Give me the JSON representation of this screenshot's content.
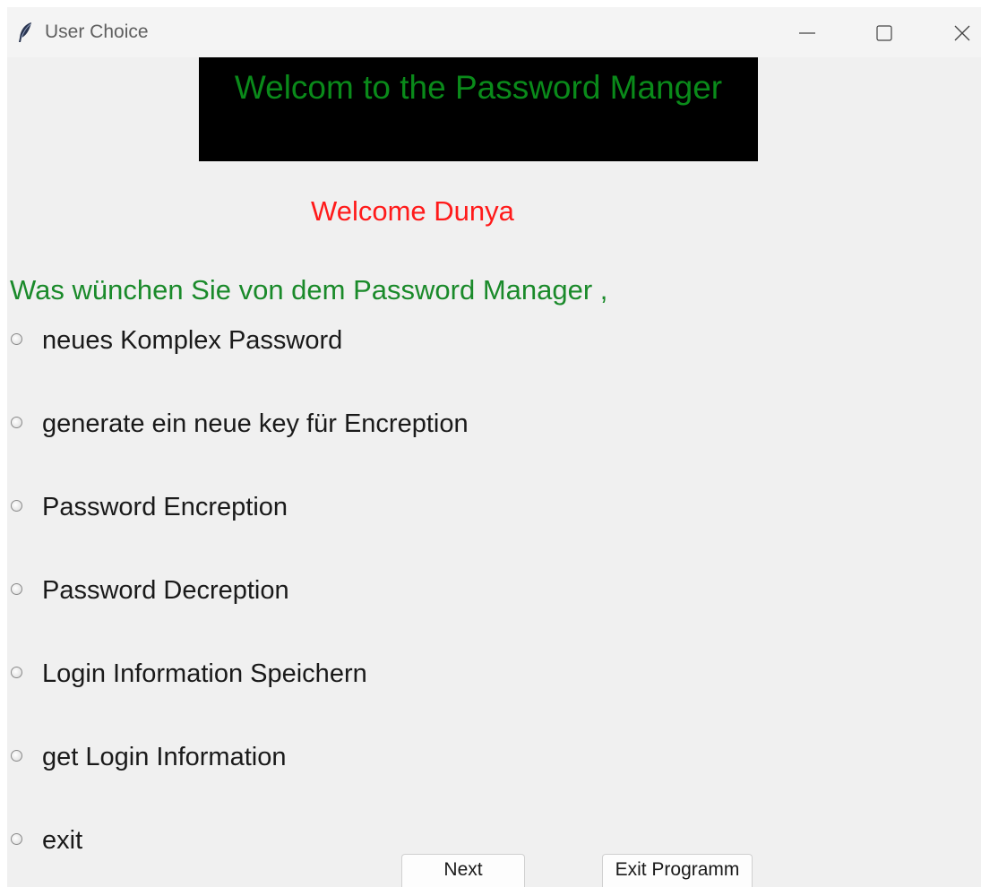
{
  "window": {
    "title": "User Choice",
    "icon": "feather-icon",
    "controls": [
      "minimize-icon",
      "maximize-icon",
      "close-icon"
    ]
  },
  "header": {
    "title": "Welcom to the Password Manger",
    "background": "#000000",
    "color": "#0a8a1a"
  },
  "welcome": {
    "text": "Welcome Dunya",
    "color": "#ff1a1a"
  },
  "question": {
    "text": "Was wünchen Sie von dem Password Manager ,",
    "color": "#1a8a2a"
  },
  "options": [
    {
      "label": " neues Komplex Password",
      "selected": false
    },
    {
      "label": "generate ein neue key für Encreption",
      "selected": false
    },
    {
      "label": "Password Encreption",
      "selected": false
    },
    {
      "label": "Password Decreption",
      "selected": false
    },
    {
      "label": "Login Information Speichern",
      "selected": false
    },
    {
      "label": "get Login Information",
      "selected": false
    },
    {
      "label": "exit",
      "selected": false
    }
  ],
  "buttons": {
    "next": "Next",
    "exit": "Exit Programm"
  }
}
